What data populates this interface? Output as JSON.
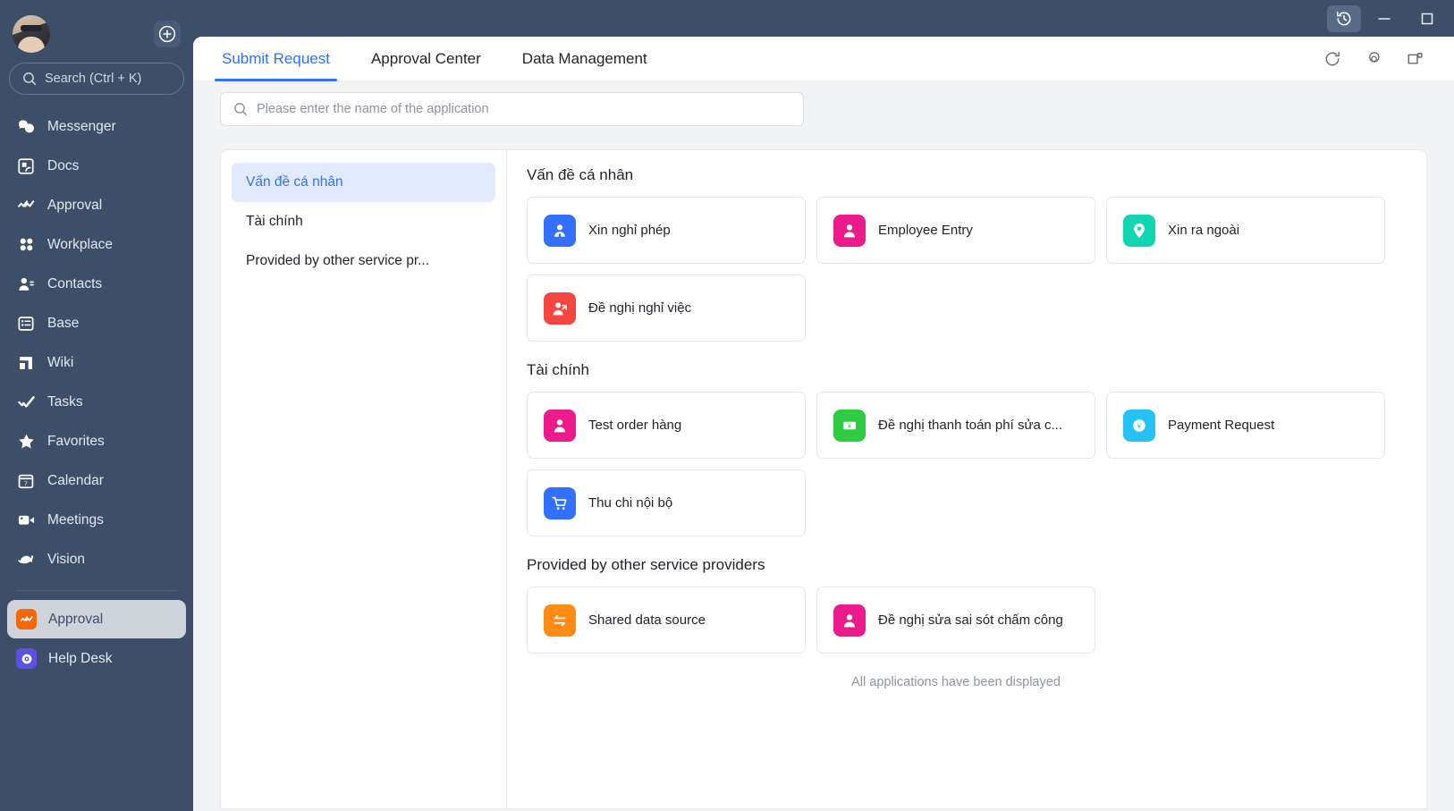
{
  "sidebar": {
    "avatar_label": "user-avatar",
    "add_button": "+",
    "search_placeholder": "Search (Ctrl + K)",
    "items": [
      {
        "label": "Messenger",
        "icon": "messenger-icon"
      },
      {
        "label": "Docs",
        "icon": "docs-icon"
      },
      {
        "label": "Approval",
        "icon": "approval-icon"
      },
      {
        "label": "Workplace",
        "icon": "workplace-icon"
      },
      {
        "label": "Contacts",
        "icon": "contacts-icon"
      },
      {
        "label": "Base",
        "icon": "base-icon"
      },
      {
        "label": "Wiki",
        "icon": "wiki-icon"
      },
      {
        "label": "Tasks",
        "icon": "tasks-icon"
      },
      {
        "label": "Favorites",
        "icon": "star-icon"
      },
      {
        "label": "Calendar",
        "icon": "calendar-icon"
      },
      {
        "label": "Meetings",
        "icon": "video-camera-icon"
      },
      {
        "label": "Vision",
        "icon": "vision-icon"
      }
    ],
    "pinned_apps": [
      {
        "label": "Approval",
        "icon": "approval-app-icon",
        "color": "#f7670a",
        "active": true
      },
      {
        "label": "Help Desk",
        "icon": "help-desk-icon",
        "color": "#5a52e0",
        "active": false
      }
    ]
  },
  "titlebar": {
    "history_icon": "history-icon",
    "minimize": "minimize-icon",
    "maximize": "maximize-icon"
  },
  "tabs": [
    {
      "label": "Submit Request",
      "active": true
    },
    {
      "label": "Approval Center",
      "active": false
    },
    {
      "label": "Data Management",
      "active": false
    }
  ],
  "tab_actions": [
    {
      "name": "refresh-icon"
    },
    {
      "name": "settings-gear-icon"
    },
    {
      "name": "open-in-new-window-icon"
    }
  ],
  "search": {
    "placeholder": "Please enter the name of the application",
    "value": ""
  },
  "clipped_text": "··",
  "categories": [
    {
      "label": "Vấn đề cá nhân",
      "active": true
    },
    {
      "label": "Tài chính",
      "active": false
    },
    {
      "label": "Provided by other service pr...",
      "active": false
    }
  ],
  "groups": [
    {
      "title": "Vấn đề cá nhân",
      "apps": [
        {
          "name": "Xin nghỉ phép",
          "icon": "person-badge-icon",
          "color": "#3370ff"
        },
        {
          "name": "Employee Entry",
          "icon": "person-icon",
          "color": "#ec1a8d"
        },
        {
          "name": "Xin ra ngoài",
          "icon": "location-pin-icon",
          "color": "#0fd6b0"
        },
        {
          "name": "Đề nghị nghỉ việc",
          "icon": "person-exit-icon",
          "color": "#f5463f"
        }
      ]
    },
    {
      "title": "Tài chính",
      "apps": [
        {
          "name": "Test order hàng",
          "icon": "person-icon",
          "color": "#ec1a8d"
        },
        {
          "name": "Đề nghị thanh toán phí sửa c...",
          "icon": "banknote-yen-icon",
          "color": "#2ecc40"
        },
        {
          "name": "Payment Request",
          "icon": "yen-coin-icon",
          "color": "#26c1f5"
        },
        {
          "name": "Thu chi nội bộ",
          "icon": "shopping-cart-icon",
          "color": "#3370ff"
        }
      ]
    },
    {
      "title": "Provided by other service providers",
      "apps": [
        {
          "name": "Shared data source",
          "icon": "exchange-arrows-icon",
          "color": "#ff8a14"
        },
        {
          "name": "Đề nghị sửa sai sót chấm công",
          "icon": "person-icon",
          "color": "#ec1a8d"
        }
      ]
    }
  ],
  "footer_note": "All applications have been displayed",
  "colors": {
    "accent": "#3370ff",
    "sidebar_bg": "#3d4e69",
    "body_bg": "#f2f3f5"
  }
}
